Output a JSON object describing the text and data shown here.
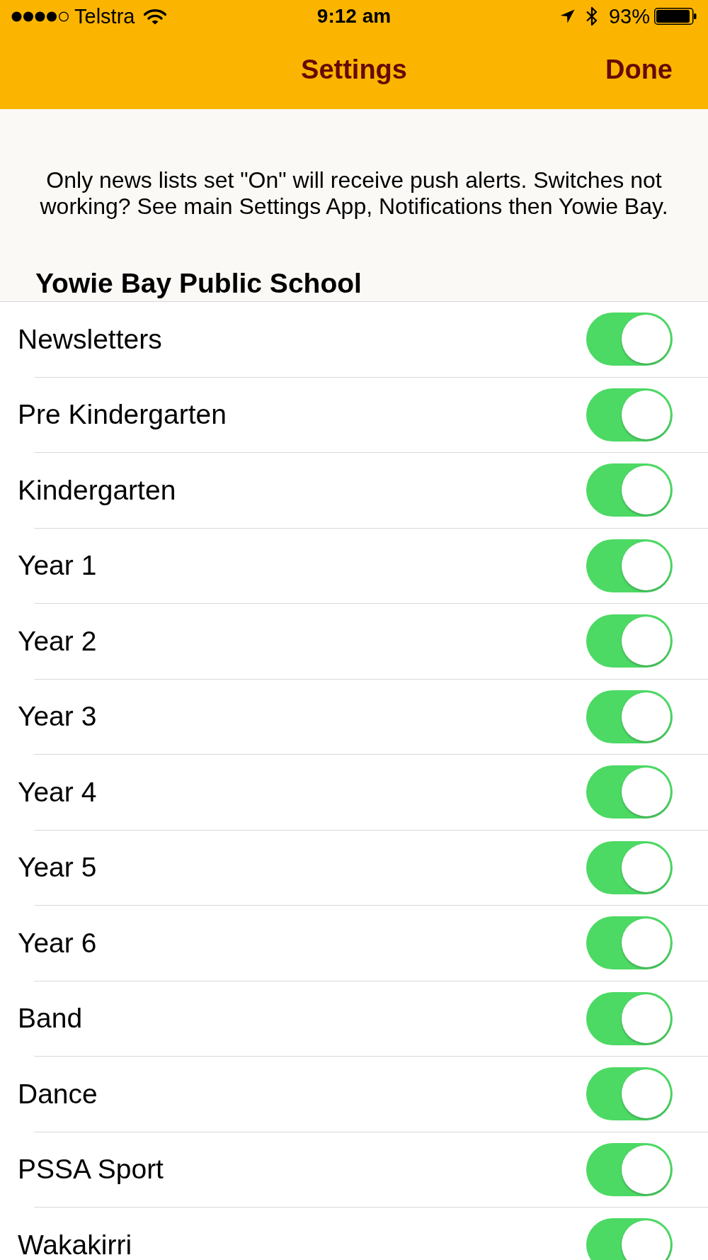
{
  "status_bar": {
    "carrier": "Telstra",
    "time": "9:12 am",
    "battery": "93%"
  },
  "nav_bar": {
    "title": "Settings",
    "done_button": "Done"
  },
  "notice": "Only news lists set \"On\" will receive push alerts. Switches not working? See main Settings App, Notifications then Yowie Bay.",
  "section": {
    "title": "Yowie Bay Public School",
    "items": [
      {
        "label": "Newsletters",
        "on": true
      },
      {
        "label": "Pre Kindergarten",
        "on": true
      },
      {
        "label": "Kindergarten",
        "on": true
      },
      {
        "label": "Year 1",
        "on": true
      },
      {
        "label": "Year 2",
        "on": true
      },
      {
        "label": "Year 3",
        "on": true
      },
      {
        "label": "Year 4",
        "on": true
      },
      {
        "label": "Year 5",
        "on": true
      },
      {
        "label": "Year 6",
        "on": true
      },
      {
        "label": "Band",
        "on": true
      },
      {
        "label": "Dance",
        "on": true
      },
      {
        "label": "PSSA Sport",
        "on": true
      },
      {
        "label": "Wakakirri",
        "on": true
      }
    ]
  }
}
